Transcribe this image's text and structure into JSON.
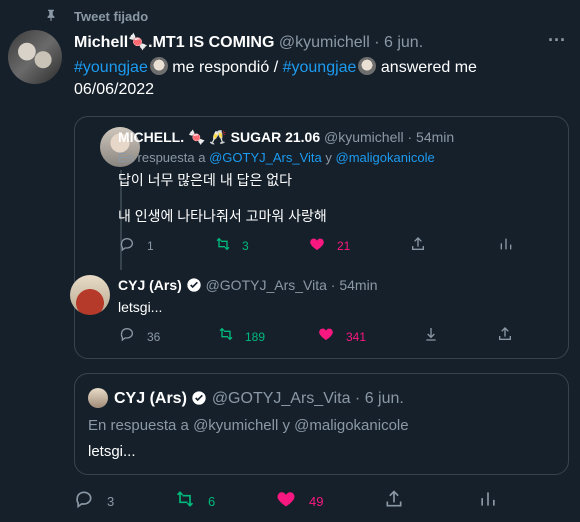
{
  "pinned": {
    "label": "Tweet fijado"
  },
  "tweet": {
    "author_name": "Michell🍬.MT1 IS COMING",
    "handle": "@kyumichell",
    "time": "· 6 jun.",
    "text_tag1": "#youngjae",
    "text_mid": "me respondió /",
    "text_tag2": "#youngjae",
    "text_end": "answered me",
    "date_line": "06/06/2022",
    "more": "···",
    "reply_count": "3",
    "retweet_count": "6",
    "like_count": "49"
  },
  "quote": {
    "reply1": {
      "author_name": "MICHELL. 🍬 🥂 SUGAR 21.06",
      "handle": "@kyumichell",
      "time": "· 54min",
      "reply_prefix": "En respuesta a",
      "reply_to1": "@GOTYJ_Ars_Vita",
      "reply_y": "y",
      "reply_to2": "@maligokanicole",
      "line1": "답이 너무 많은데 내 답은 없다",
      "line2": "내 인생에 나타나줘서 고마워 사랑해",
      "reply_count": "1",
      "retweet_count": "3",
      "like_count": "21"
    },
    "reply2": {
      "author_name": "CYJ (Ars)",
      "handle": "@GOTYJ_Ars_Vita",
      "time": "· 54min",
      "text": "letsgi...",
      "reply_count": "36",
      "retweet_count": "189",
      "like_count": "341"
    }
  },
  "quote2": {
    "author_name": "CYJ (Ars)",
    "handle": "@GOTYJ_Ars_Vita",
    "time": "· 6 jun.",
    "reply_line": "En respuesta a @kyumichell y @maligokanicole",
    "text": "letsgi..."
  },
  "colors": {
    "background": "#15202b",
    "accent": "#1d9bf0",
    "like": "#f91880",
    "retweet": "#00ba7c",
    "muted": "#8b98a5"
  }
}
